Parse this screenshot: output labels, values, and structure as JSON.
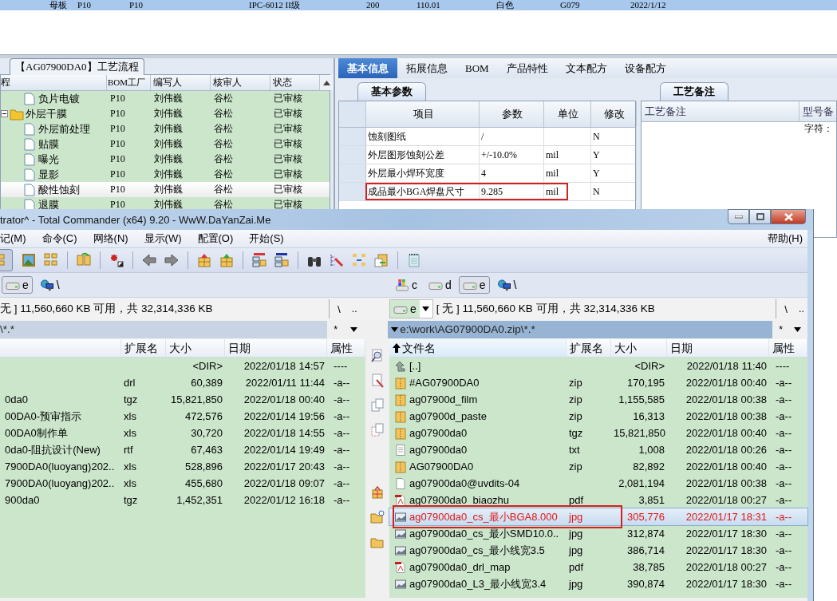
{
  "top_row": {
    "cells": [
      "母板",
      "P10",
      "P10",
      "IPC-6012 II级",
      "200",
      "110.01",
      "白色",
      "G079",
      "2022/1/12"
    ]
  },
  "process_panel": {
    "title": "【AG07900DA0】工艺流程",
    "columns": [
      "程",
      "BOM工厂",
      "编写人",
      "核审人",
      "状态"
    ],
    "tree": [
      {
        "children": [
          {
            "name": "负片电镀",
            "kind": "step",
            "bom": "P10",
            "author": "刘伟巍",
            "reviewer": "谷松",
            "status": "已审核",
            "selected": false
          }
        ]
      },
      {
        "name": "外层干膜",
        "kind": "folder",
        "expanded": true,
        "bom": "P10",
        "author": "刘伟巍",
        "reviewer": "谷松",
        "status": "已审核",
        "selected": false,
        "children": [
          {
            "name": "外层前处理",
            "kind": "step",
            "bom": "P10",
            "author": "刘伟巍",
            "reviewer": "谷松",
            "status": "已审核",
            "selected": false
          },
          {
            "name": "贴膜",
            "kind": "step",
            "bom": "P10",
            "author": "刘伟巍",
            "reviewer": "谷松",
            "status": "已审核",
            "selected": false
          },
          {
            "name": "曝光",
            "kind": "step",
            "bom": "P10",
            "author": "刘伟巍",
            "reviewer": "谷松",
            "status": "已审核",
            "selected": false
          },
          {
            "name": "显影",
            "kind": "step",
            "bom": "P10",
            "author": "刘伟巍",
            "reviewer": "谷松",
            "status": "已审核",
            "selected": false
          },
          {
            "name": "酸性蚀刻",
            "kind": "step",
            "bom": "P10",
            "author": "刘伟巍",
            "reviewer": "谷松",
            "status": "已审核",
            "selected": true
          },
          {
            "name": "退膜",
            "kind": "step",
            "bom": "P10",
            "author": "刘伟巍",
            "reviewer": "谷松",
            "status": "已审核",
            "selected": false
          }
        ]
      }
    ]
  },
  "detail_tabs": [
    {
      "label": "基本信息",
      "selected": true
    },
    {
      "label": "拓展信息",
      "selected": false
    },
    {
      "label": "BOM",
      "selected": false
    },
    {
      "label": "产品特性",
      "selected": false
    },
    {
      "label": "文本配方",
      "selected": false
    },
    {
      "label": "设备配方",
      "selected": false
    }
  ],
  "params_panel": {
    "tab": "基本参数",
    "columns": [
      "项目",
      "参数",
      "单位",
      "修改"
    ],
    "rows": [
      {
        "item": "蚀刻图纸",
        "value": "/",
        "modified": "N",
        "highlighted": false
      },
      {
        "item": "外层图形蚀刻公差",
        "value": "+/-10.0%",
        "unit": "mil",
        "modified": "Y",
        "highlighted": false
      },
      {
        "item": "外层最小焊环宽度",
        "value": "4",
        "unit": "mil",
        "modified": "Y",
        "highlighted": false
      },
      {
        "item": "成品最小BGA焊盘尺寸",
        "value": "9.285",
        "unit": "mil",
        "modified": "N",
        "highlighted": true
      }
    ]
  },
  "notes_panel": {
    "tab": "工艺备注",
    "columns": [
      "工艺备注",
      "型号备"
    ],
    "text": "字符："
  },
  "total_commander": {
    "title": "trator^ - Total Commander (x64) 9.20 - WwW.DaYanZai.Me",
    "menu": [
      "记(M)",
      "命令(C)",
      "网络(N)",
      "显示(W)",
      "配置(O)",
      "开始(S)"
    ],
    "menu_right": "帮助(H)",
    "left": {
      "active": false,
      "drives": [
        {
          "label": "e",
          "kind": "drive",
          "selected": true
        },
        {
          "label": "\\",
          "kind": "network",
          "selected": false
        }
      ],
      "info": "无 ] 11,560,660 KB 可用，共 32,314,336 KB",
      "root": "\\",
      "up": "..",
      "path": "\\*.*",
      "filter": "*",
      "columns": [
        "扩展名",
        "大小",
        "日期",
        "属性"
      ],
      "files": [
        {
          "size": "<DIR>",
          "date": "2022/01/18 14:57",
          "attr": "----",
          "selected": false,
          "highlighted": false
        },
        {
          "ext": "drl",
          "size": "60,389",
          "date": "2022/01/11 11:44",
          "attr": "-a--",
          "selected": false,
          "highlighted": false
        },
        {
          "name": "0da0",
          "ext": "tgz",
          "size": "15,821,850",
          "date": "2022/01/18 00:40",
          "attr": "-a--",
          "selected": false,
          "highlighted": false
        },
        {
          "name": "00DA0-预审指示",
          "ext": "xls",
          "size": "472,576",
          "date": "2022/01/14 19:56",
          "attr": "-a--",
          "selected": false,
          "highlighted": false
        },
        {
          "name": "00DA0制作单",
          "ext": "xls",
          "size": "30,720",
          "date": "2022/01/18 14:55",
          "attr": "-a--",
          "selected": false,
          "highlighted": false
        },
        {
          "name": "0da0-阻抗设计(New)",
          "ext": "rtf",
          "size": "67,463",
          "date": "2022/01/14 19:49",
          "attr": "-a--",
          "selected": false,
          "highlighted": false
        },
        {
          "name": "7900DA0(luoyang)202..",
          "ext": "xls",
          "size": "528,896",
          "date": "2022/01/17 20:43",
          "attr": "-a--",
          "selected": false,
          "highlighted": false
        },
        {
          "name": "7900DA0(luoyang)202..",
          "ext": "xls",
          "size": "455,680",
          "date": "2022/01/18 09:07",
          "attr": "-a--",
          "selected": false,
          "highlighted": false
        },
        {
          "name": "900da0",
          "ext": "tgz",
          "size": "1,452,351",
          "date": "2022/01/12 16:18",
          "attr": "-a--",
          "selected": false,
          "highlighted": false
        }
      ]
    },
    "right": {
      "active": true,
      "drives": [
        {
          "label": "c",
          "kind": "system",
          "selected": false
        },
        {
          "label": "d",
          "kind": "drive",
          "selected": false
        },
        {
          "label": "e",
          "kind": "drive",
          "selected": true
        },
        {
          "label": "\\",
          "kind": "network",
          "selected": false
        }
      ],
      "combo": "e",
      "info": "[ 无 ] 11,560,660 KB 可用，共 32,314,336 KB",
      "root": "\\",
      "up": "..",
      "path": "e:\\work\\AG07900DA0.zip\\*.*",
      "filter": "*",
      "columns": [
        "文件名",
        "扩展名",
        "大小",
        "日期",
        "属性"
      ],
      "files": [
        {
          "name": "[..]",
          "kind": "up",
          "size": "<DIR>",
          "date": "2022/01/18 11:40",
          "attr": "----",
          "selected": false,
          "highlighted": false
        },
        {
          "name": "#AG07900DA0",
          "kind": "archive",
          "ext": "zip",
          "size": "170,195",
          "date": "2022/01/18 00:40",
          "attr": "-a--",
          "selected": false,
          "highlighted": false
        },
        {
          "name": "ag07900d_film",
          "kind": "archive",
          "ext": "zip",
          "size": "1,155,585",
          "date": "2022/01/18 00:38",
          "attr": "-a--",
          "selected": false,
          "highlighted": false
        },
        {
          "name": "ag07900d_paste",
          "kind": "archive",
          "ext": "zip",
          "size": "16,313",
          "date": "2022/01/18 00:38",
          "attr": "-a--",
          "selected": false,
          "highlighted": false
        },
        {
          "name": "ag07900da0",
          "kind": "archive",
          "ext": "tgz",
          "size": "15,821,850",
          "date": "2022/01/18 00:40",
          "attr": "-a--",
          "selected": false,
          "highlighted": false
        },
        {
          "name": "ag07900da0",
          "kind": "text",
          "ext": "txt",
          "size": "1,008",
          "date": "2022/01/18 00:26",
          "attr": "-a--",
          "selected": false,
          "highlighted": false
        },
        {
          "name": "AG07900DA0",
          "kind": "archive",
          "ext": "zip",
          "size": "82,892",
          "date": "2022/01/18 00:40",
          "attr": "-a--",
          "selected": false,
          "highlighted": false
        },
        {
          "name": "ag07900da0@uvdits-04",
          "kind": "file",
          "size": "2,081,194",
          "date": "2022/01/18 00:38",
          "attr": "-a--",
          "selected": false,
          "highlighted": false
        },
        {
          "name": "ag07900da0_biaozhu",
          "kind": "pdf",
          "ext": "pdf",
          "size": "3,851",
          "date": "2022/01/18 00:27",
          "attr": "-a--",
          "selected": false,
          "highlighted": false
        },
        {
          "name": "ag07900da0_cs_最小BGA8.000",
          "kind": "image",
          "ext": "jpg",
          "size": "305,776",
          "date": "2022/01/17 18:31",
          "attr": "-a--",
          "selected": true,
          "highlighted": true
        },
        {
          "name": "ag07900da0_cs_最小SMD10.0..",
          "kind": "image",
          "ext": "jpg",
          "size": "312,874",
          "date": "2022/01/17 18:30",
          "attr": "-a--",
          "selected": false,
          "highlighted": false
        },
        {
          "name": "ag07900da0_cs_最小线宽3.5",
          "kind": "image",
          "ext": "jpg",
          "size": "386,714",
          "date": "2022/01/17 18:30",
          "attr": "-a--",
          "selected": false,
          "highlighted": false
        },
        {
          "name": "ag07900da0_drl_map",
          "kind": "pdf",
          "ext": "pdf",
          "size": "38,785",
          "date": "2022/01/18 00:27",
          "attr": "-a--",
          "selected": false,
          "highlighted": false
        },
        {
          "name": "ag07900da0_L3_最小线宽3.4",
          "kind": "image",
          "ext": "jpg",
          "size": "390,874",
          "date": "2022/01/17 18:30",
          "attr": "-a--",
          "selected": false,
          "highlighted": false
        }
      ]
    }
  }
}
